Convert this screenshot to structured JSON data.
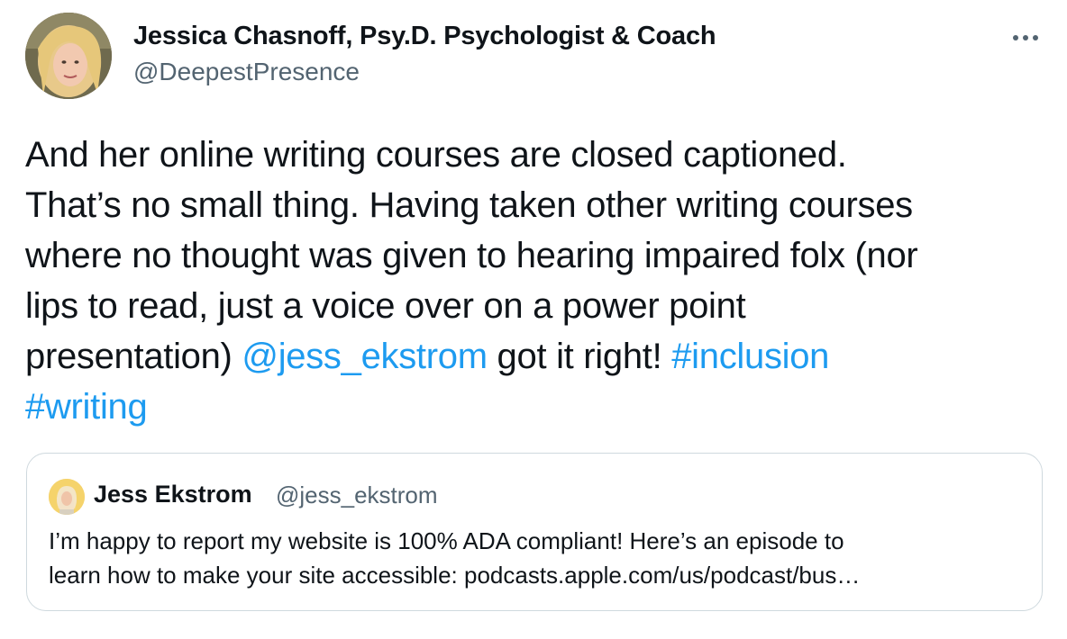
{
  "tweet": {
    "author_name": "Jessica Chasnoff, Psy.D. Psychologist & Coach",
    "author_handle": "@DeepestPresence",
    "avatar_icon": "user-avatar-photo",
    "more_icon": "more-horizontal-icon",
    "text_line1": "And her online writing courses are closed captioned.",
    "text_line2": "That’s no small thing. Having taken other writing courses",
    "text_line3": "where no thought was given to hearing impaired folx (nor",
    "text_line4": "lips to read, just a voice over on a power point",
    "text_line5_pre": "presentation) ",
    "mention": "@jess_ekstrom",
    "text_line5_mid": " got it right! ",
    "hashtag1": "#inclusion",
    "hashtag2": "#writing"
  },
  "quote": {
    "author_name": "Jess Ekstrom",
    "author_handle": "@jess_ekstrom",
    "avatar_icon": "user-avatar-photo",
    "text_line1": "I’m happy to report my website is 100% ADA compliant! Here’s an episode to",
    "text_line2": "learn how to make your site accessible: podcasts.apple.com/us/podcast/bus…"
  },
  "colors": {
    "link": "#1d9bf0",
    "secondary_text": "#536471",
    "border": "#cfd9de",
    "text": "#0f1419"
  }
}
